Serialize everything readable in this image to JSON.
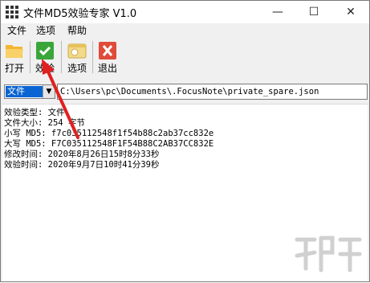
{
  "window": {
    "title": "文件MD5效验专家 V1.0"
  },
  "controls": {
    "minimize": "—",
    "maximize": "☐",
    "close": "✕"
  },
  "menu": [
    {
      "label": "文件"
    },
    {
      "label": "选项"
    },
    {
      "label": "帮助"
    }
  ],
  "toolbar": {
    "open_label": "打开",
    "verify_label": "效验",
    "options_label": "选项",
    "exit_label": "退出"
  },
  "path": {
    "type_selected": "文件",
    "value": "C:\\Users\\pc\\Documents\\.FocusNote\\private_spare.json"
  },
  "result": {
    "lines": [
      "效验类型: 文件",
      "文件大小: 254 字节",
      "小写 MD5: f7c035112548f1f54b88c2ab37cc832e",
      "大写 MD5: F7C035112548F1F54B88C2AB37CC832E",
      "修改时间: 2020年8月26日15时8分33秒",
      "效验时间: 2020年9月7日10时41分39秒"
    ]
  },
  "colors": {
    "verify_green": "#3aa63a",
    "exit_red": "#e04b3a",
    "arrow_red": "#e02020",
    "selection_blue": "#0a64d2"
  }
}
